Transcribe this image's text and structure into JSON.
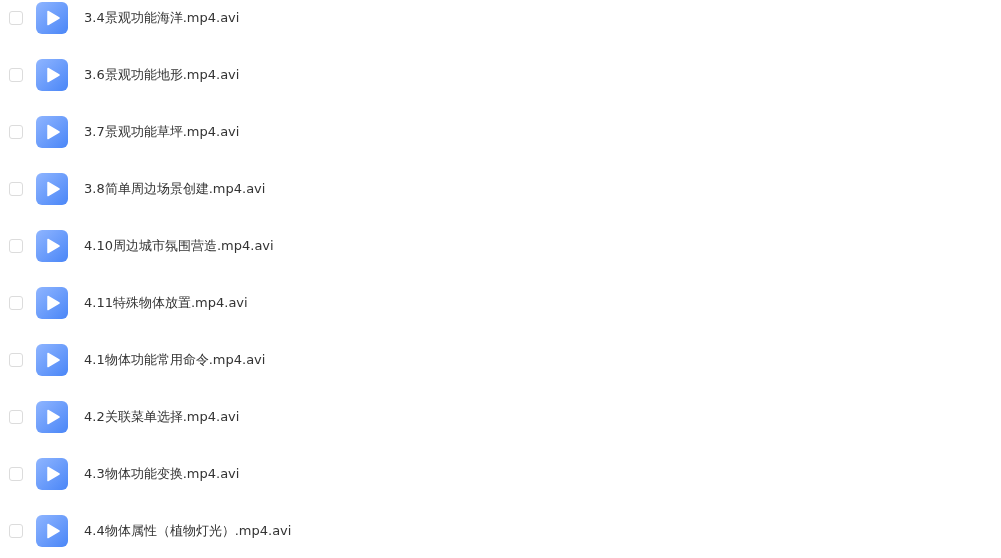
{
  "files": [
    {
      "name": "3.4景观功能海洋.mp4.avi",
      "checked": false
    },
    {
      "name": "3.6景观功能地形.mp4.avi",
      "checked": false
    },
    {
      "name": "3.7景观功能草坪.mp4.avi",
      "checked": false
    },
    {
      "name": "3.8简单周边场景创建.mp4.avi",
      "checked": false
    },
    {
      "name": "4.10周边城市氛围营造.mp4.avi",
      "checked": false
    },
    {
      "name": "4.11特殊物体放置.mp4.avi",
      "checked": false
    },
    {
      "name": "4.1物体功能常用命令.mp4.avi",
      "checked": false
    },
    {
      "name": "4.2关联菜单选择.mp4.avi",
      "checked": false
    },
    {
      "name": "4.3物体功能变换.mp4.avi",
      "checked": false
    },
    {
      "name": "4.4物体属性（植物灯光）.mp4.avi",
      "checked": false
    }
  ]
}
